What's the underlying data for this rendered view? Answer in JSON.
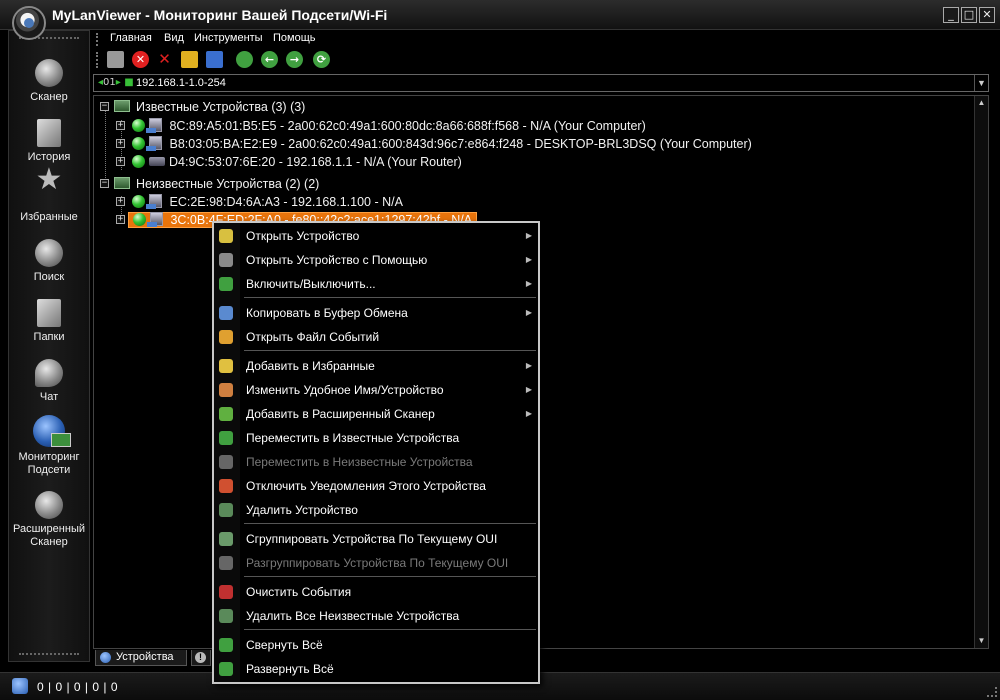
{
  "window": {
    "title": "MyLanViewer - Мониторинг Вашей Подсети/Wi-Fi",
    "btn_min": "_",
    "btn_max": "□",
    "btn_close": "✕"
  },
  "sidebar": {
    "items": [
      {
        "label": "Сканер",
        "icon": "scanner-icon"
      },
      {
        "label": "История",
        "icon": "history-icon"
      },
      {
        "label": "Избранные",
        "icon": "star-icon"
      },
      {
        "label": "Поиск",
        "icon": "search-icon"
      },
      {
        "label": "Папки",
        "icon": "folders-icon"
      },
      {
        "label": "Чат",
        "icon": "chat-icon"
      },
      {
        "label": "Мониторинг Подсети",
        "icon": "network-monitor-icon"
      },
      {
        "label": "Расширенный Сканер",
        "icon": "advanced-scanner-icon"
      }
    ]
  },
  "menubar": {
    "items": [
      "Главная",
      "Вид",
      "Инструменты",
      "Помощь"
    ]
  },
  "toolbar": {
    "buttons": [
      {
        "icon": "network-scan-icon",
        "color": "#cccccc"
      },
      {
        "icon": "stop-icon",
        "color": "#e02020"
      },
      {
        "icon": "delete-icon",
        "color": "#d02020"
      },
      {
        "icon": "open-folder-icon",
        "color": "#e0b020"
      },
      {
        "icon": "save-icon",
        "color": "#3a6fd0"
      },
      {
        "icon": "search-icon",
        "color": "#40a040"
      },
      {
        "icon": "back-icon",
        "color": "#40a040"
      },
      {
        "icon": "forward-icon",
        "color": "#40a040"
      },
      {
        "icon": "refresh-icon",
        "color": "#40a040"
      }
    ]
  },
  "address": {
    "prefix": "01",
    "value": "192.168.1-1.0-254"
  },
  "tree": {
    "groups": [
      {
        "label": "Известные Устройства (3) (3)",
        "devices": [
          "8C:89:A5:01:B5:E5 - 2a00:62c0:49a1:600:80dc:8a66:688f:f568 - N/A (Your Computer)",
          "B8:03:05:BA:E2:E9 - 2a00:62c0:49a1:600:843d:96c7:e864:f248 - DESKTOP-BRL3DSQ (Your Computer)",
          "D4:9C:53:07:6E:20 - 192.168.1.1 - N/A (Your Router)"
        ]
      },
      {
        "label": "Неизвестные Устройства (2) (2)",
        "devices": [
          "EC:2E:98:D4:6A:A3 - 192.168.1.100 - N/A",
          "3C:0B:4F:ED:2F:A0 - fe80::42c2:ace1:1297:42bf - N/A"
        ]
      }
    ]
  },
  "tabs": {
    "devices": "Устройства"
  },
  "statusbar": {
    "text": "0 | 0 | 0 | 0 | 0"
  },
  "context_menu": {
    "items": [
      {
        "label": "Открыть Устройство",
        "submenu": true,
        "disabled": false,
        "icon": "open-device-icon"
      },
      {
        "label": "Открыть Устройство с Помощью",
        "submenu": true,
        "disabled": false,
        "icon": "open-with-icon"
      },
      {
        "label": "Включить/Выключить...",
        "submenu": true,
        "disabled": false,
        "icon": "power-icon"
      },
      {
        "label": "Копировать в Буфер Обмена",
        "submenu": true,
        "disabled": false,
        "icon": "copy-icon"
      },
      {
        "label": "Открыть Файл Событий",
        "submenu": false,
        "disabled": false,
        "icon": "events-file-icon"
      },
      {
        "label": "Добавить в Избранные",
        "submenu": true,
        "disabled": false,
        "icon": "add-favorite-icon"
      },
      {
        "label": "Изменить Удобное Имя/Устройство",
        "submenu": true,
        "disabled": false,
        "icon": "rename-icon"
      },
      {
        "label": "Добавить в Расширенный Сканер",
        "submenu": true,
        "disabled": false,
        "icon": "add-scanner-icon"
      },
      {
        "label": "Переместить в Известные Устройства",
        "submenu": false,
        "disabled": false,
        "icon": "move-known-icon"
      },
      {
        "label": "Переместить в Неизвестные Устройства",
        "submenu": false,
        "disabled": true,
        "icon": "move-unknown-icon"
      },
      {
        "label": "Отключить Уведомления Этого Устройства",
        "submenu": false,
        "disabled": false,
        "icon": "mute-notifications-icon"
      },
      {
        "label": "Удалить Устройство",
        "submenu": false,
        "disabled": false,
        "icon": "delete-device-icon"
      },
      {
        "label": "Сгруппировать Устройства По Текущему OUI",
        "submenu": false,
        "disabled": false,
        "icon": "group-icon"
      },
      {
        "label": "Разгруппировать Устройства По Текущему OUI",
        "submenu": false,
        "disabled": true,
        "icon": "ungroup-icon"
      },
      {
        "label": "Очистить События",
        "submenu": false,
        "disabled": false,
        "icon": "clear-events-icon"
      },
      {
        "label": "Удалить Все Неизвестные Устройства",
        "submenu": false,
        "disabled": false,
        "icon": "delete-all-unknown-icon"
      },
      {
        "label": "Свернуть Всё",
        "submenu": false,
        "disabled": false,
        "icon": "collapse-all-icon"
      },
      {
        "label": "Развернуть Всё",
        "submenu": false,
        "disabled": false,
        "icon": "expand-all-icon"
      }
    ]
  },
  "colors": {
    "selection": "#e8740c",
    "online": "#33c433",
    "menu_border": "#c8c8c8"
  }
}
